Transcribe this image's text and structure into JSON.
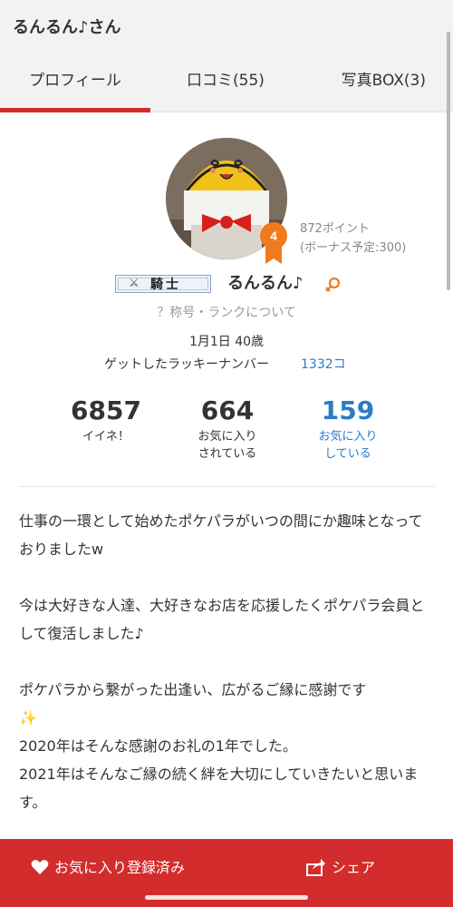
{
  "header": {
    "title": "るんるん♪さん"
  },
  "tabs": [
    {
      "label": "プロフィール",
      "active": true
    },
    {
      "label": "口コミ(55)",
      "active": false
    },
    {
      "label": "写真BOX(3)",
      "active": false
    }
  ],
  "profile": {
    "rank_number": "4",
    "points": "872ポイント",
    "bonus": "(ボーナス予定:300)",
    "title_badge": "騎士",
    "username": "るんるん♪",
    "rank_link": "？称号・ランクについて",
    "birthday_age": "1月1日 40歳",
    "lucky_label": "ゲットしたラッキーナンバー",
    "lucky_value": "1332コ"
  },
  "stats": [
    {
      "value": "6857",
      "label_line1": "イイネ！",
      "label_line2": ""
    },
    {
      "value": "664",
      "label_line1": "お気に入り",
      "label_line2": "されている"
    },
    {
      "value": "159",
      "label_line1": "お気に入り",
      "label_line2": "している"
    }
  ],
  "bio": {
    "p1": "仕事の一環として始めたポケパラがいつの間にか趣味となっておりましたw",
    "p2": "今は大好きな人達、大好きなお店を応援したくポケパラ会員として復活しました♪",
    "p3_line1": "ポケパラから繋がった出逢い、広がるご縁に感謝です",
    "p3_sparkle": "✨",
    "p3_line2": "2020年はそんな感謝のお礼の1年でした。",
    "p3_line3": "2021年はそんなご縁の続く絆を大切にしていきたいと思います。"
  },
  "footer": {
    "favorite_label": "お気に入り登録済み",
    "share_label": "シェア"
  },
  "colors": {
    "accent_red": "#d32c2c",
    "link_blue": "#2a7bc8",
    "rank_orange": "#f07a1e"
  },
  "icons": {
    "favorite": "heart-icon",
    "share": "share-icon",
    "gender": "female-icon",
    "title_badge": "crossed-swords-icon"
  }
}
